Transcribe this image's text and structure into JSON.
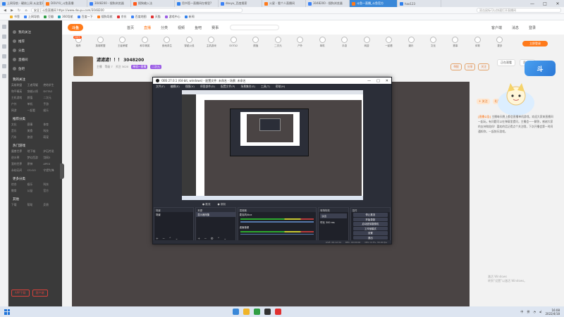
{
  "browser": {
    "tabs": [
      {
        "label": "上网导航 - 硬核上网 从这里开始",
        "color": "#2f80ed"
      },
      {
        "label": "DOUYU_斗鱼直播",
        "color": "#ff7a1a"
      },
      {
        "label": "3048200 - 搜狗浏览器",
        "color": "#3b82f6"
      },
      {
        "label": "搜狗输入法",
        "color": "#ff5a1a"
      },
      {
        "label": "用书签一直播间在哪里?",
        "color": "#2f80ed"
      },
      {
        "label": "douyu_百度搜索",
        "color": "#3b82f6"
      },
      {
        "label": "火星 - 看个人直播间",
        "color": "#ff7a1a"
      },
      {
        "label": "3048200 - 搜狗浏览器",
        "color": "#3b82f6"
      },
      {
        "label": "斗鱼一直播_斗鱼官方",
        "color": "#ff7a1a",
        "active": true
      },
      {
        "label": "hao123",
        "color": "#2f80ed"
      }
    ],
    "url": "安全 | 斗鱼直播间 https://www.douyu.com/3048200",
    "search_placeholder": "双击鼠标可以快速打开直播间",
    "bookmarks": [
      "书签",
      "上网导航",
      "豆瓣",
      "360导航",
      "百度一下",
      "搜狗导航",
      "京东",
      "百度地图",
      "天猫",
      "游戏中心",
      "新闻"
    ]
  },
  "site": {
    "logo": "斗鱼",
    "nav": [
      "首页",
      "直播",
      "分类",
      "视频",
      "鱼吧",
      "赛事"
    ],
    "nav_active": "直播",
    "header_right": [
      "客户端",
      "消息",
      "登录"
    ],
    "categories": [
      "推荐",
      "英雄联盟",
      "王者荣耀",
      "和平精英",
      "绝地求生",
      "穿越火线",
      "主机游戏",
      "DOTA2",
      "颜值",
      "二次元",
      "户外",
      "单机",
      "手游",
      "网游",
      "一起看",
      "娱乐",
      "文化",
      "赛事",
      "体育",
      "更多"
    ],
    "category_badge": "HOT",
    "login_pill": "立即登录",
    "sidebar": {
      "main_items": [
        "我的关注",
        "推荐",
        "分类",
        "直播间",
        "鱼吧"
      ],
      "sections": [
        {
          "title": "我的关注",
          "items": [
            "英雄联盟",
            "王者荣耀",
            "绝地求生",
            "和平精英",
            "穿越火线",
            "DOTA2",
            "主机游戏",
            "颜值",
            "二次元",
            "户外",
            "单机",
            "手游",
            "网游",
            "一起看",
            "娱乐"
          ]
        },
        {
          "title": "推荐分类",
          "items": [
            "文化",
            "赛事",
            "体育",
            "音乐",
            "美食",
            "科技",
            "汽车",
            "旅游",
            "萌宠"
          ]
        },
        {
          "title": "热门游戏",
          "items": [
            "魔兽世界",
            "地下城",
            "炉石传说",
            "逆水寒",
            "梦幻西游",
            "剑网3",
            "我的世界",
            "原神",
            "APEX",
            "永劫无间",
            "CS:GO",
            "守望先锋"
          ]
        },
        {
          "title": "更多分类",
          "items": [
            "综合",
            "娱乐",
            "科技",
            "教育",
            "公益",
            "官方"
          ]
        },
        {
          "title": "其他",
          "items": [
            "下载",
            "帮助",
            "反馈"
          ]
        }
      ],
      "bottom_buttons": [
        "APP下载",
        "客户端"
      ]
    }
  },
  "streamer": {
    "title": "滤滤滤！！！ 3048200",
    "meta": [
      "主播",
      "等级 7",
      "关注 3020"
    ],
    "tags": [
      "单机一直播",
      "二次元"
    ],
    "tools": [
      "举报",
      "分享",
      "关注"
    ]
  },
  "right_panel": {
    "head": [
      "正在观看",
      "贡献榜"
    ],
    "big_logo": "斗",
    "pills": [
      "+ 关注",
      "礼物"
    ],
    "announcement_label": "[直播公告]",
    "announcement": "主播每天晚上都会直播单机游戏，欢迎大家来直播间一起玩，有问题可以在弹幕里提问，主播会一一解答，感谢大家的支持和陪伴！喜欢的话记得点个关注哦，下次开播会第一时间通知你，一起快乐游戏。",
    "watermark_lines": [
      "激活 Windows",
      "转到“设置”以激活 Windows。"
    ]
  },
  "obs": {
    "title": "OBS 27.0.1 (64-bit, windows) - 配置文件: 未命名 - 场景: 未命名",
    "menu": [
      "文件(F)",
      "编辑(E)",
      "视图(V)",
      "停靠部件(D)",
      "配置文件(P)",
      "场景集合(S)",
      "工具(T)",
      "帮助(H)"
    ],
    "below": [
      "● 推流",
      "● 录制"
    ],
    "docks": {
      "scenes": {
        "title": "场景",
        "items": [
          "场景"
        ]
      },
      "sources": {
        "title": "来源",
        "items": [
          "显示器采集"
        ]
      },
      "mixer": {
        "title": "混音器",
        "channels": [
          "麦克风/Aux",
          "桌面音频"
        ],
        "db": "0.0 dB"
      },
      "transitions": {
        "title": "转场特效",
        "type": "淡出",
        "duration_label": "时长",
        "duration": "300 ms"
      },
      "controls": {
        "title": "控件",
        "buttons": [
          "停止推流",
          "开始录制",
          "启动虚拟摄像机",
          "工作室模式",
          "设置",
          "退出"
        ]
      }
    },
    "status": [
      "LIVE: 00:12:34",
      "REC: 00:00:00",
      "CPU: 6.3%, 30.00 fps"
    ]
  },
  "taskbar": {
    "tray": [
      "中",
      "拼"
    ],
    "time": "16:08",
    "date": "2022/4/18"
  }
}
